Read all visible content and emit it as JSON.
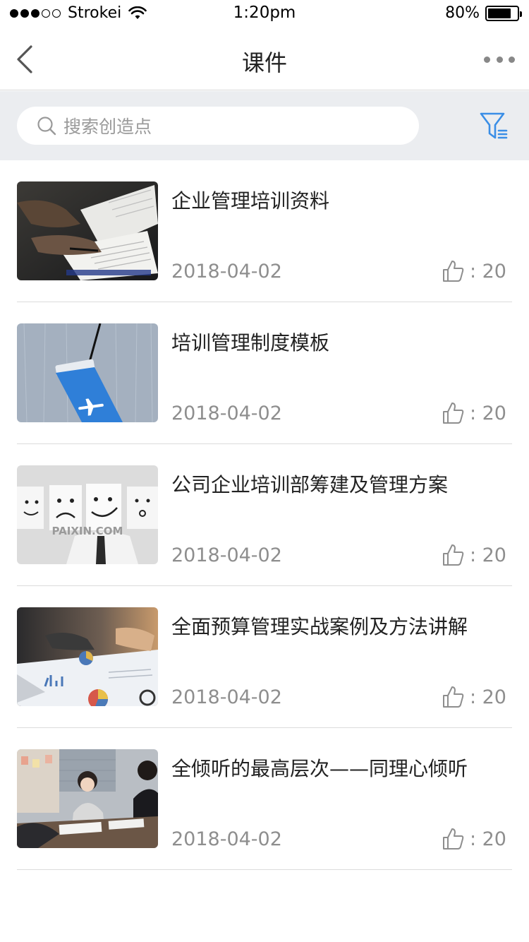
{
  "status_bar": {
    "carrier": "Strokei",
    "time": "1:20pm",
    "battery": "80%",
    "battery_level": 0.8,
    "signal_dots_filled": 3,
    "signal_dots_total": 5
  },
  "nav": {
    "title": "课件",
    "back_icon": "chevron-left-icon",
    "more_icon": "ellipsis-icon"
  },
  "search": {
    "placeholder": "搜索创造点",
    "icon": "search-icon",
    "filter_icon": "filter-icon"
  },
  "colors": {
    "accent": "#3a8ee6",
    "search_bg": "#ebedf0",
    "secondary_text": "#8e8e8e"
  },
  "courses": [
    {
      "title": "企业管理培训资料",
      "date": "2018-04-02",
      "likes": ": 20",
      "thumbnail": "document-signing"
    },
    {
      "title": "培训管理制度模板",
      "date": "2018-04-02",
      "likes": ": 20",
      "thumbnail": "paint-roller-airplane"
    },
    {
      "title": "公司企业培训部筹建及管理方案",
      "date": "2018-04-02",
      "likes": ": 20",
      "thumbnail": "emotion-faces",
      "thumbnail_watermark": "PAIXIN.COM"
    },
    {
      "title": "全面预算管理实战案例及方法讲解",
      "date": "2018-04-02",
      "likes": ": 20",
      "thumbnail": "financial-charts"
    },
    {
      "title": "全倾听的最高层次——同理心倾听",
      "date": "2018-04-02",
      "likes": ": 20",
      "thumbnail": "business-meeting"
    }
  ]
}
